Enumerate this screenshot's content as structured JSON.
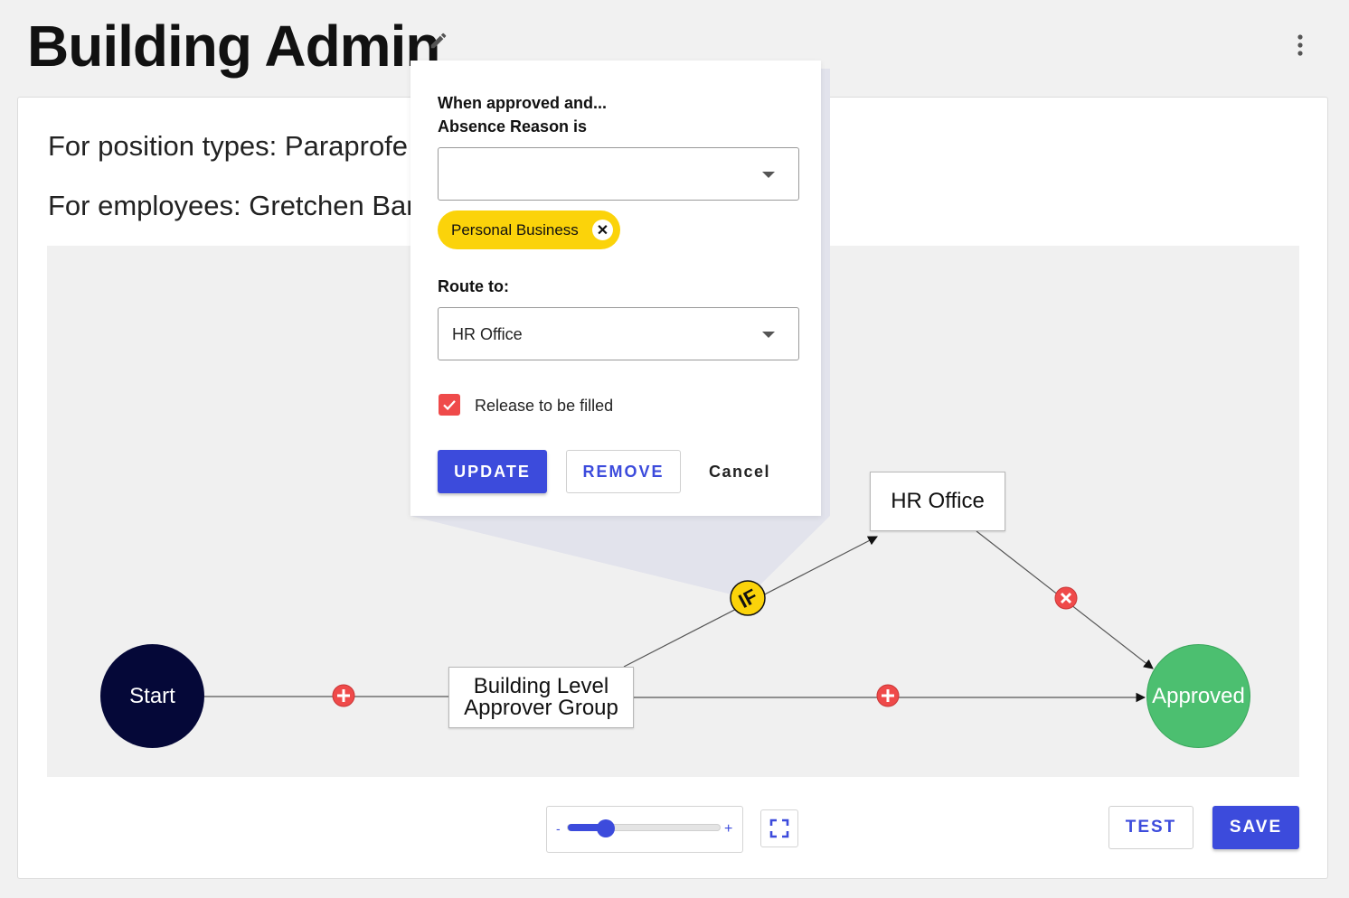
{
  "header": {
    "title": "Building Admin",
    "edit_icon": "pencil-icon",
    "more_icon": "more-vertical-icon"
  },
  "criteria": {
    "position_types": "For position types: Paraprofe",
    "employees": "For employees: Gretchen Bar"
  },
  "flow": {
    "start_label": "Start",
    "approver_group_line1": "Building Level",
    "approver_group_line2": "Approver Group",
    "hr_office_label": "HR Office",
    "approved_label": "Approved",
    "if_badge_label": "IF",
    "colors": {
      "start": "#050838",
      "approved": "#4cbf70",
      "add_step": "#ef4a4a",
      "if_badge": "#fbd30a"
    }
  },
  "popover": {
    "heading_line1": "When approved and...",
    "heading_line2": "Absence Reason is",
    "absence_reason_value": "",
    "selected_reason_chip": "Personal Business",
    "route_to_label": "Route to:",
    "route_to_value": "HR Office",
    "release_checkbox_label": "Release to be filled",
    "release_checked": true,
    "update_label": "UPDATE",
    "remove_label": "REMOVE",
    "cancel_label": "Cancel"
  },
  "zoom": {
    "minus_label": "-",
    "plus_label": "+",
    "level_fraction": 0.25
  },
  "actions": {
    "test_label": "TEST",
    "save_label": "SAVE",
    "accent_color": "#3c4bdc"
  }
}
